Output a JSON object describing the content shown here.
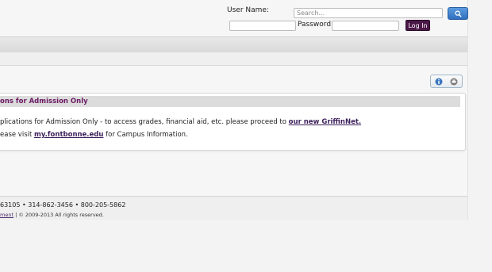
{
  "login": {
    "user_label": "User Name:",
    "password_label": "Password:",
    "search_placeholder": "Search...",
    "login_button": "Log In"
  },
  "content": {
    "heading": "ons for Admission Only",
    "line1_text": "plications for Admission Only - to access grades, financial aid, etc. please proceed to ",
    "line1_link": "our new GriffinNet.",
    "line2_prefix": "ease visit ",
    "line2_link": "my.fontbonne.edu",
    "line2_suffix": " for Campus Information."
  },
  "footer": {
    "contact": "63105  •  314-862-3456  •  800-205-5862",
    "link": "ment",
    "copyright": " | © 2009-2013 All rights reserved."
  },
  "colors": {
    "accent_purple": "#6b1a63",
    "login_button": "#4a1846",
    "search_button": "#2f6fbf"
  }
}
